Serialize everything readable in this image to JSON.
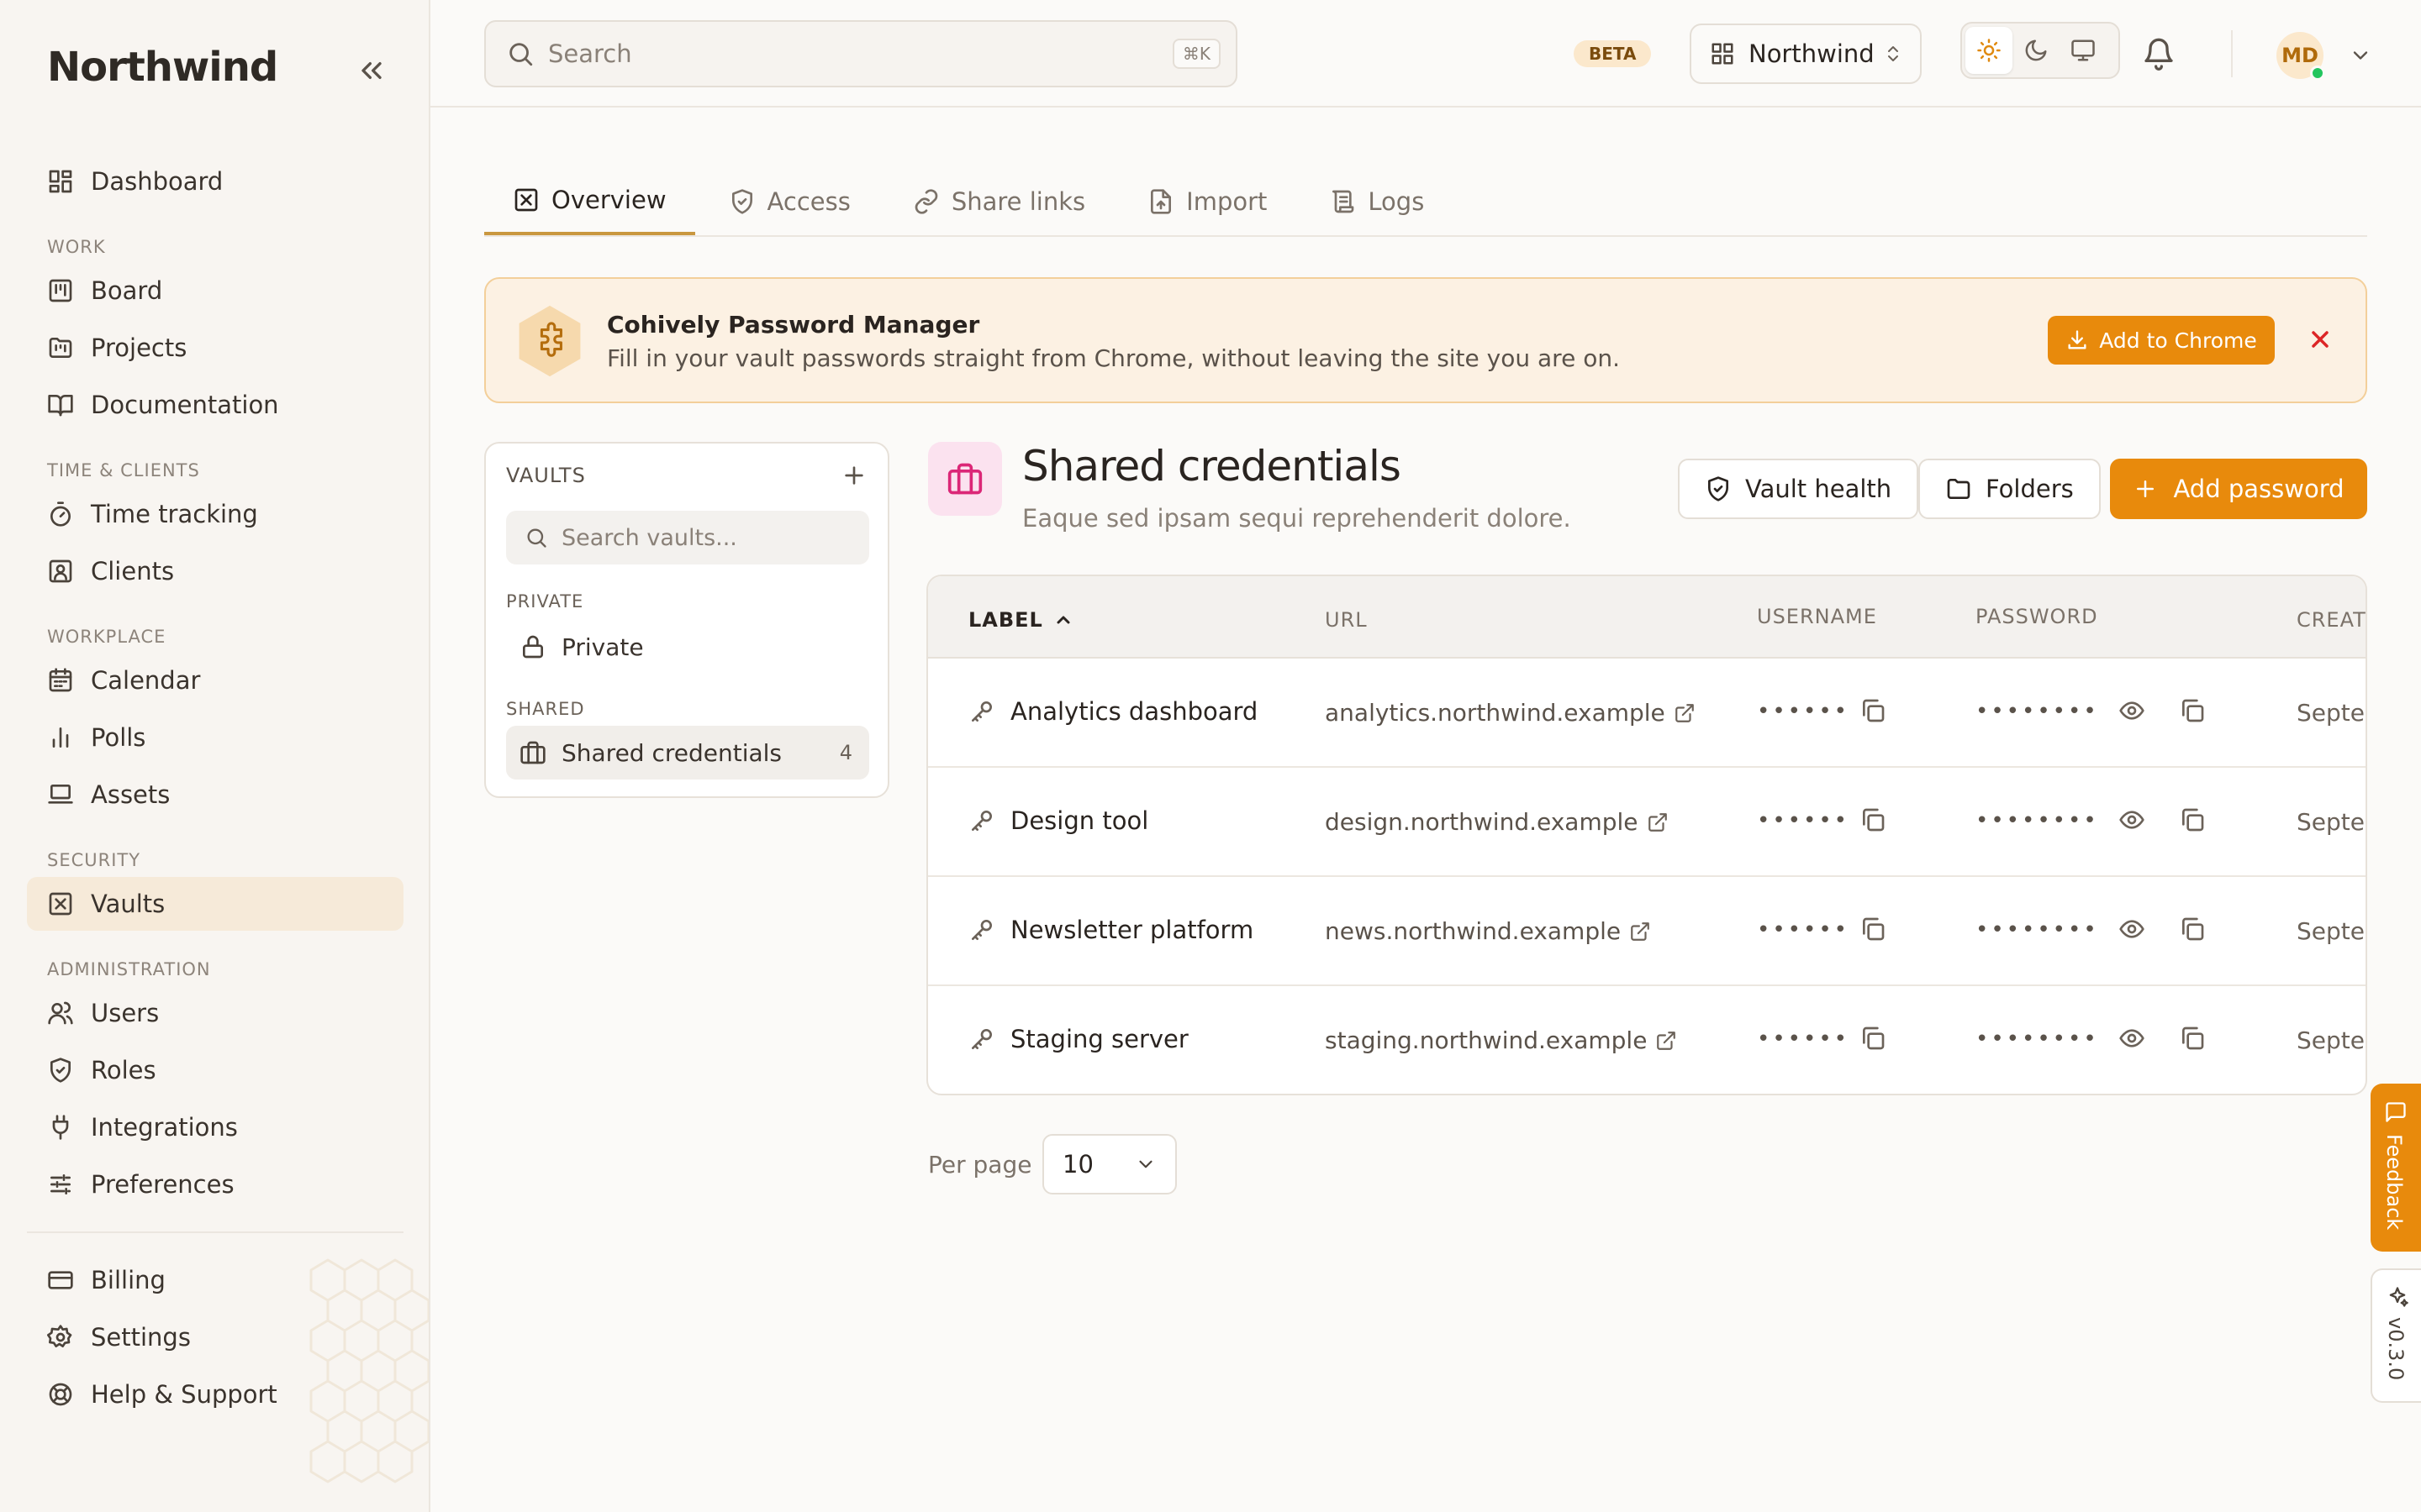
{
  "sidebar": {
    "brand": "Northwind",
    "items": {
      "dashboard": "Dashboard",
      "board": "Board",
      "projects": "Projects",
      "documentation": "Documentation",
      "time_tracking": "Time tracking",
      "clients": "Clients",
      "calendar": "Calendar",
      "polls": "Polls",
      "assets": "Assets",
      "vaults": "Vaults",
      "users": "Users",
      "roles": "Roles",
      "integrations": "Integrations",
      "preferences": "Preferences",
      "billing": "Billing",
      "settings": "Settings",
      "help": "Help & Support"
    },
    "groups": {
      "work": "WORK",
      "time_clients": "TIME & CLIENTS",
      "workplace": "WORKPLACE",
      "security": "SECURITY",
      "administration": "ADMINISTRATION"
    }
  },
  "topbar": {
    "search_placeholder": "Search",
    "shortcut": "⌘K",
    "beta": "BETA",
    "workspace": "Northwind",
    "avatar_initials": "MD"
  },
  "tabs": [
    "Overview",
    "Access",
    "Share links",
    "Import",
    "Logs"
  ],
  "banner": {
    "title": "Cohively Password Manager",
    "subtitle": "Fill in your vault passwords straight from Chrome, without leaving the site you are on.",
    "cta": "Add to Chrome"
  },
  "vaults": {
    "heading": "VAULTS",
    "search_placeholder": "Search vaults...",
    "private_group": "PRIVATE",
    "private_item": "Private",
    "shared_group": "SHARED",
    "shared_item": "Shared credentials",
    "shared_count": "4"
  },
  "detail": {
    "title": "Shared credentials",
    "subtitle": "Eaque sed ipsam sequi reprehenderit dolore.",
    "vault_health": "Vault health",
    "folders": "Folders",
    "add_password": "Add password"
  },
  "table": {
    "headers": {
      "label": "LABEL",
      "url": "URL",
      "username": "USERNAME",
      "password": "PASSWORD",
      "created": "CREATE"
    },
    "rows": [
      {
        "label": "Analytics dashboard",
        "url": "analytics.northwind.example",
        "username": "••••••",
        "password": "••••••••",
        "created": "Septer"
      },
      {
        "label": "Design tool",
        "url": "design.northwind.example",
        "username": "••••••",
        "password": "••••••••",
        "created": "Septer"
      },
      {
        "label": "Newsletter platform",
        "url": "news.northwind.example",
        "username": "••••••",
        "password": "••••••••",
        "created": "Septer"
      },
      {
        "label": "Staging server",
        "url": "staging.northwind.example",
        "username": "••••••",
        "password": "••••••••",
        "created": "Septer"
      }
    ]
  },
  "pagination": {
    "label": "Per page",
    "value": "10"
  },
  "edge": {
    "feedback": "Feedback",
    "version": "v0.3.0"
  },
  "colors": {
    "accent": "#e88a0c",
    "active_nav": "#f6ead9",
    "banner_bg": "#fcf1e3",
    "vault_icon": "#db2777",
    "online": "#22c55e"
  }
}
